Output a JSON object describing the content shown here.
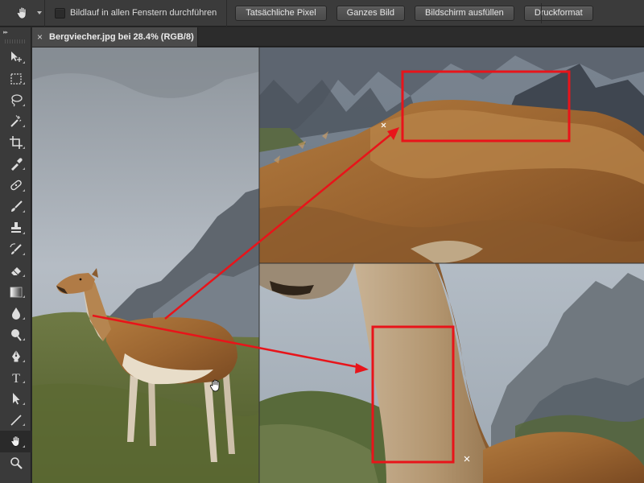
{
  "options_bar": {
    "scroll_all_label": "Bildlauf in allen Fenstern durchführen",
    "buttons": [
      "Tatsächliche Pixel",
      "Ganzes Bild",
      "Bildschirm ausfüllen",
      "Druckformat"
    ]
  },
  "document": {
    "tab_title": "Bergviecher.jpg bei 28.4% (RGB/8)",
    "close_glyph": "×"
  },
  "tools": [
    {
      "name": "move-icon"
    },
    {
      "name": "marquee-icon"
    },
    {
      "name": "lasso-icon"
    },
    {
      "name": "magic-wand-icon"
    },
    {
      "name": "crop-icon"
    },
    {
      "name": "eyedropper-icon"
    },
    {
      "name": "healing-brush-icon"
    },
    {
      "name": "brush-icon"
    },
    {
      "name": "stamp-icon"
    },
    {
      "name": "history-brush-icon"
    },
    {
      "name": "eraser-icon"
    },
    {
      "name": "gradient-icon"
    },
    {
      "name": "blur-icon"
    },
    {
      "name": "dodge-icon"
    },
    {
      "name": "pen-icon"
    },
    {
      "name": "type-icon"
    },
    {
      "name": "path-selection-icon"
    },
    {
      "name": "line-icon"
    },
    {
      "name": "hand-icon"
    },
    {
      "name": "zoom-icon"
    }
  ],
  "type_tool_glyph": "T",
  "colors": {
    "annotation_red": "#e8141a",
    "ui_panel": "#3a3a3a",
    "active_tool": "#2a2a2a"
  }
}
